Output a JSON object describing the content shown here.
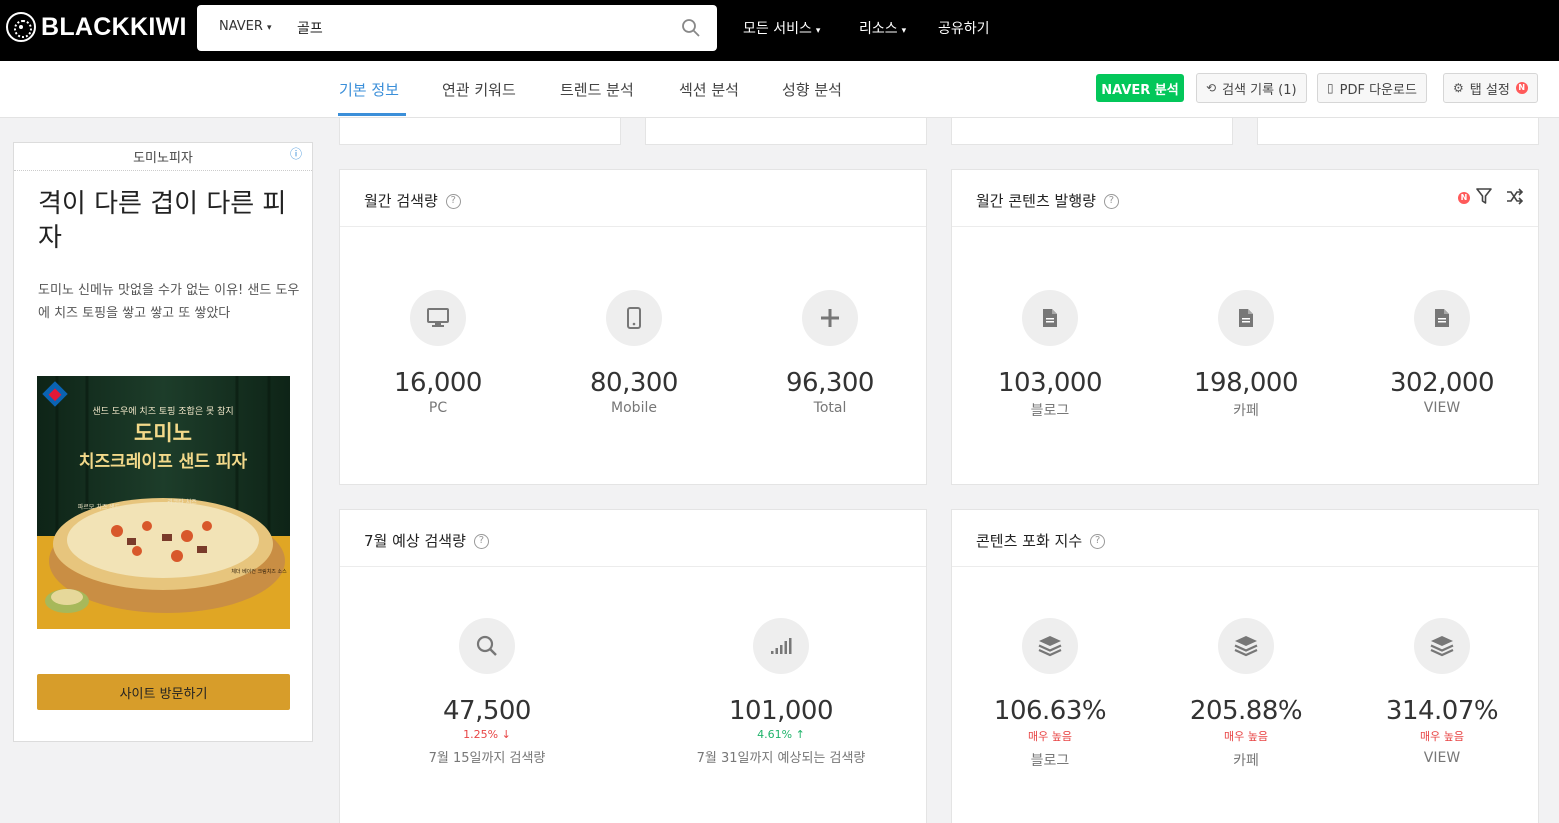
{
  "header": {
    "logo_text": "BLACKKIWI",
    "search": {
      "engine": "NAVER",
      "query": "골프"
    },
    "nav": [
      {
        "label": "모든 서비스",
        "has_dropdown": true
      },
      {
        "label": "리소스",
        "has_dropdown": true
      },
      {
        "label": "공유하기",
        "has_dropdown": false
      }
    ]
  },
  "tabs": [
    {
      "label": "기본 정보",
      "active": true
    },
    {
      "label": "연관 키워드",
      "active": false
    },
    {
      "label": "트렌드 분석",
      "active": false
    },
    {
      "label": "섹션 분석",
      "active": false
    },
    {
      "label": "성향 분석",
      "active": false
    }
  ],
  "toolbar": {
    "naver_label": "NAVER 분석",
    "history_label": "검색 기록 (1)",
    "pdf_label": "PDF 다운로드",
    "tab_settings_label": "탭 설정",
    "new_badge": "N"
  },
  "ad": {
    "brand": "도미노피자",
    "info_icon": "info-icon",
    "title": "격이 다른 겹이 다른 피자",
    "description": "도미노 신메뉴 맛없을 수가 없는 이유! 샌드 도우에 치즈 토핑을 쌓고 쌓고 또 쌓았다",
    "image": {
      "tagline": "샌드 도우에 치즈 토핑 조합은 못 참지",
      "headline1": "도미노",
      "headline2": "치즈크레이프 샌드 피자",
      "note1": "파르모 치즈 샌드",
      "note2": "리코타 치즈",
      "note3": "체더 베이컨 크림치즈 소스"
    },
    "cta": "사이트 방문하기"
  },
  "cards": {
    "monthly_search": {
      "title": "월간 검색량",
      "items": [
        {
          "icon": "monitor-icon",
          "value": "16,000",
          "label": "PC"
        },
        {
          "icon": "mobile-icon",
          "value": "80,300",
          "label": "Mobile"
        },
        {
          "icon": "plus-icon",
          "value": "96,300",
          "label": "Total"
        }
      ]
    },
    "monthly_content": {
      "title": "월간 콘텐츠 발행량",
      "badge": "N",
      "items": [
        {
          "icon": "document-icon",
          "value": "103,000",
          "label": "블로그"
        },
        {
          "icon": "document-icon",
          "value": "198,000",
          "label": "카페"
        },
        {
          "icon": "document-icon",
          "value": "302,000",
          "label": "VIEW"
        }
      ]
    },
    "forecast": {
      "title": "7월 예상 검색량",
      "items": [
        {
          "icon": "search-icon",
          "value": "47,500",
          "change": "1.25%",
          "direction": "down",
          "label": "7월 15일까지 검색량"
        },
        {
          "icon": "signal-icon",
          "value": "101,000",
          "change": "4.61%",
          "direction": "up",
          "label": "7월 31일까지 예상되는 검색량"
        }
      ]
    },
    "saturation": {
      "title": "콘텐츠 포화 지수",
      "items": [
        {
          "icon": "layers-icon",
          "value": "106.63%",
          "level": "매우 높음",
          "label": "블로그"
        },
        {
          "icon": "layers-icon",
          "value": "205.88%",
          "level": "매우 높음",
          "label": "카페"
        },
        {
          "icon": "layers-icon",
          "value": "314.07%",
          "level": "매우 높음",
          "label": "VIEW"
        }
      ]
    }
  },
  "colors": {
    "accent": "#3b8fd9",
    "naver_green": "#03c75a",
    "down_red": "#e84545",
    "up_green": "#1fb36a",
    "ad_button": "#d79d2a"
  }
}
